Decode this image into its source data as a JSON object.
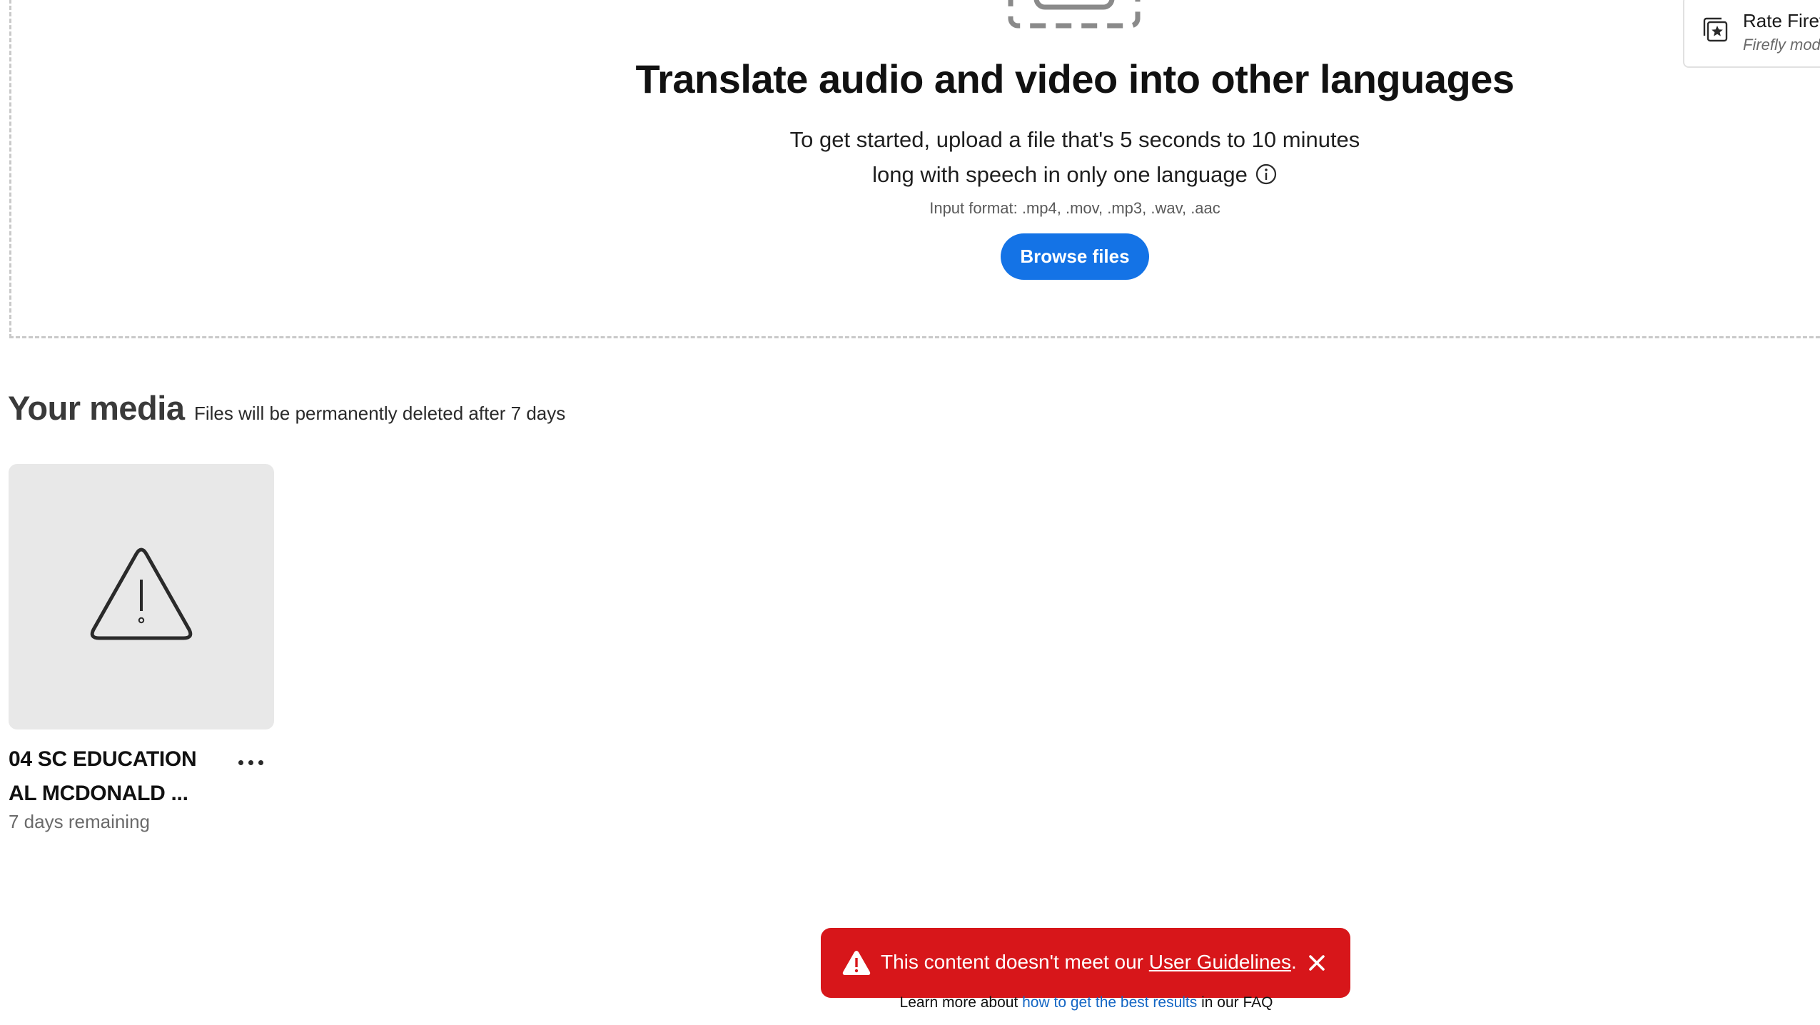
{
  "upload": {
    "title": "Translate audio and video into other languages",
    "description_line1": "To get started, upload a file that's 5 seconds to 10 minutes",
    "description_line2": "long with speech in only one language",
    "formats": "Input format: .mp4, .mov, .mp3, .wav, .aac",
    "browse_label": "Browse files"
  },
  "rate_panel": {
    "title": "Rate Firef",
    "subtitle": "Firefly mode"
  },
  "media": {
    "heading": "Your media",
    "note": "Files will be permanently deleted after 7 days",
    "items": [
      {
        "title_line1": "04 SC EDUCATION",
        "title_line2": "AL MCDONALD ...",
        "remaining": "7 days remaining",
        "status_icon": "warning-icon"
      }
    ]
  },
  "toast": {
    "message": "This content doesn't meet our ",
    "link_label": "User Guidelines",
    "suffix": ".",
    "background": "#d7161a"
  },
  "faq": {
    "prefix": "Learn more about ",
    "link_label": "how to get the best results",
    "suffix": " in our FAQ"
  },
  "colors": {
    "accent": "#1473e6",
    "error": "#d7161a",
    "link": "#1466c4"
  }
}
